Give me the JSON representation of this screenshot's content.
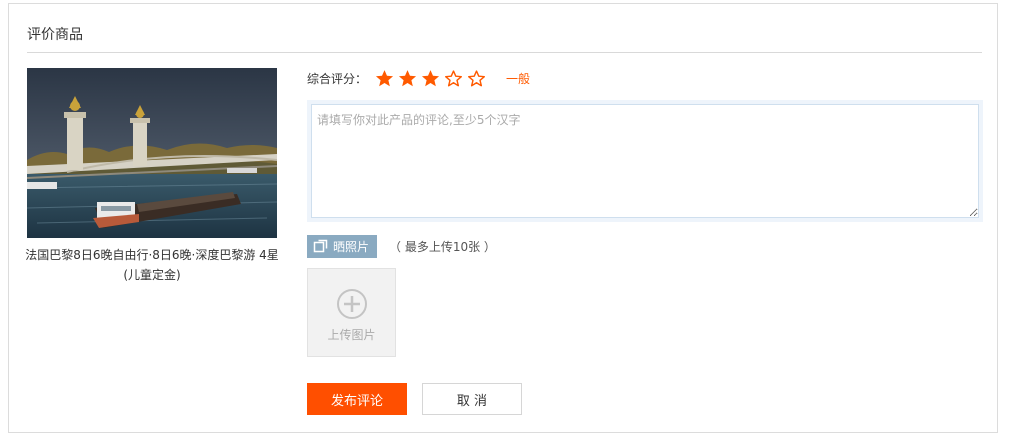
{
  "panel": {
    "title": "评价商品"
  },
  "product": {
    "name": "法国巴黎8日6晚自由行·8日6晚·深度巴黎游 4星(儿童定金)",
    "image_icon": "paris-bridge-photo"
  },
  "rating": {
    "label": "综合评分：",
    "value": 3,
    "max": 5,
    "text": "一般",
    "star_color": "#ff5a00"
  },
  "comment": {
    "placeholder": "请填写你对此产品的评论,至少5个汉字",
    "value": ""
  },
  "photo_upload": {
    "button_label": "晒照片",
    "button_icon": "copy-images-icon",
    "hint": "（ 最多上传10张 ）",
    "box_label": "上传图片",
    "box_icon": "plus-circle-icon"
  },
  "actions": {
    "submit_label": "发布评论",
    "cancel_label": "取 消"
  },
  "colors": {
    "accent": "#ff4f00",
    "photo_button": "#8aaac1"
  }
}
